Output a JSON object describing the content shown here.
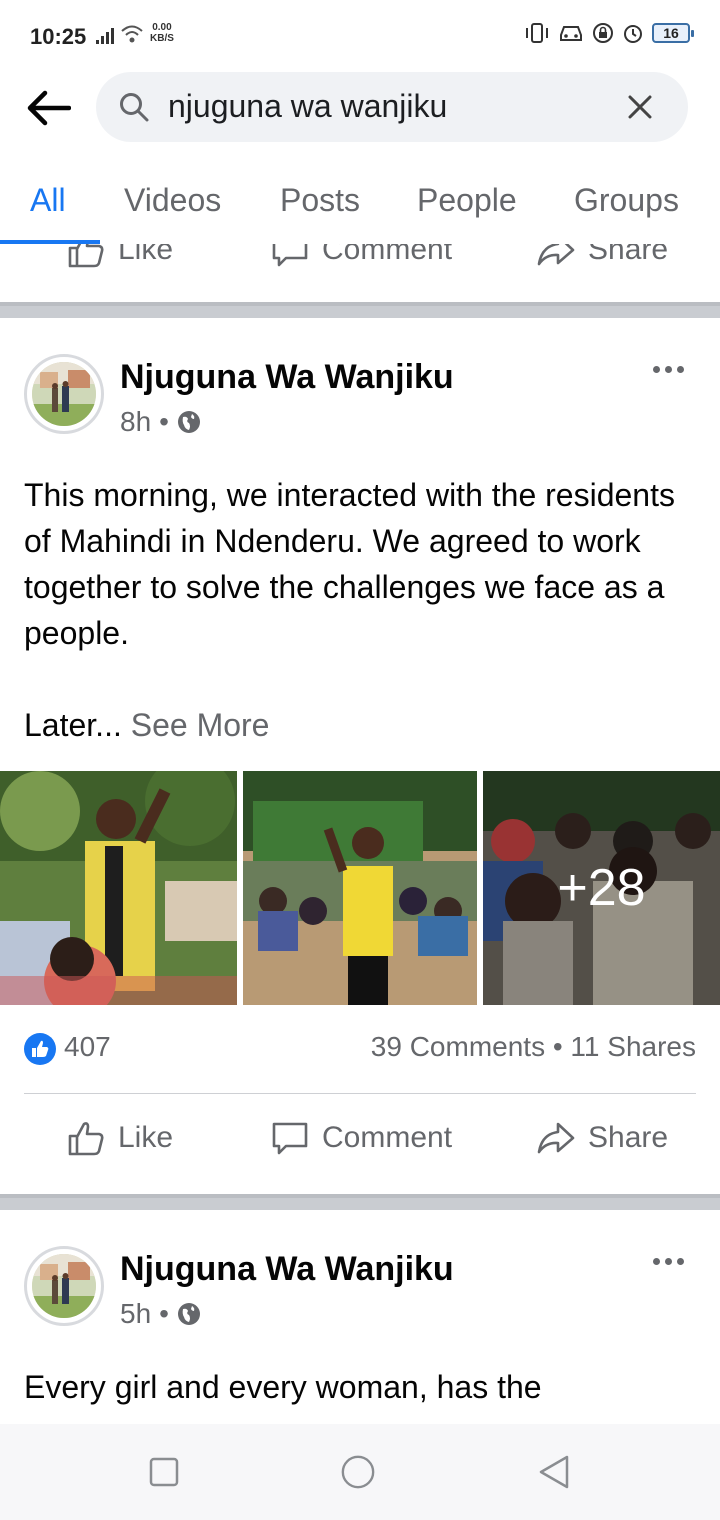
{
  "status_bar": {
    "time": "10:25",
    "speed_value": "0.00",
    "speed_unit": "KB/S",
    "battery": "16"
  },
  "search": {
    "query": "njuguna wa wanjiku"
  },
  "tabs": [
    {
      "label": "All",
      "active": true
    },
    {
      "label": "Videos",
      "active": false
    },
    {
      "label": "Posts",
      "active": false
    },
    {
      "label": "People",
      "active": false
    },
    {
      "label": "Groups",
      "active": false
    }
  ],
  "previous_post_actions": {
    "like": "Like",
    "comment": "Comment",
    "share": "Share"
  },
  "posts": [
    {
      "author": "Njuguna Wa Wanjiku",
      "time": "8h",
      "text": "This morning, we interacted with the residents of Mahindi in  Ndenderu. We agreed to work together to solve the challenges we face as a people.",
      "truncated_text": "Later...",
      "see_more": "See More",
      "extra_photos": "+28",
      "likes": "407",
      "comments_shares": "39 Comments • 11 Shares",
      "actions": {
        "like": "Like",
        "comment": "Comment",
        "share": "Share"
      }
    },
    {
      "author": "Njuguna Wa Wanjiku",
      "time": "5h",
      "text": "Every girl and every woman, has the"
    }
  ],
  "colors": {
    "accent": "#1877f2",
    "secondary_text": "#65676b",
    "divider": "#c9ccd1"
  }
}
